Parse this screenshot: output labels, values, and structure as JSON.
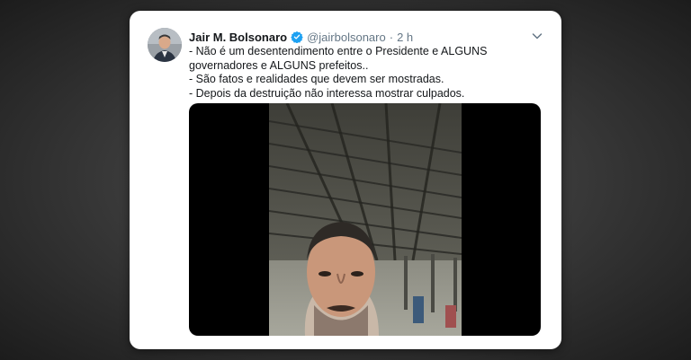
{
  "tweet": {
    "author_name": "Jair M. Bolsonaro",
    "handle": "@jairbolsonaro",
    "separator": "·",
    "time": "2 h",
    "lines": [
      "- Não é um desentendimento entre o Presidente e ALGUNS governadores e ALGUNS prefeitos..",
      "- São fatos e realidades que devem ser mostradas.",
      "- Depois da destruição não interessa mostrar culpados."
    ]
  },
  "icons": {
    "verified": "verified-badge-icon",
    "more": "chevron-down-icon"
  },
  "colors": {
    "verified_blue": "#1da1f2",
    "text": "#14171a",
    "secondary": "#657786"
  }
}
